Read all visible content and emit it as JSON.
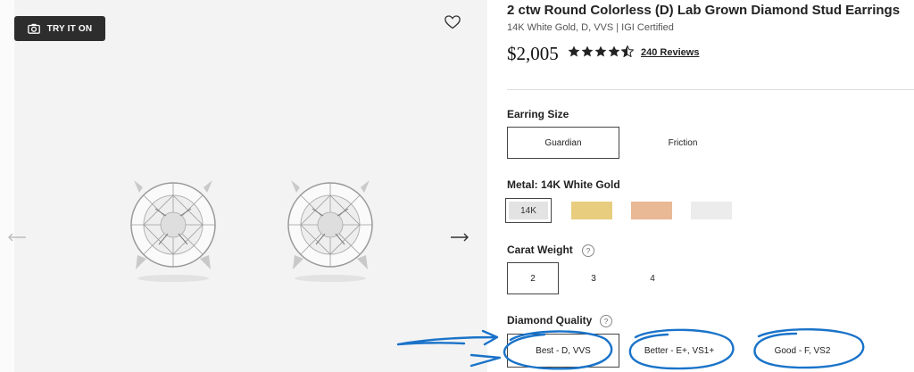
{
  "gallery": {
    "try_on_label": "TRY IT ON"
  },
  "product": {
    "title": "2 ctw Round Colorless (D) Lab Grown Diamond Stud Earrings",
    "subtitle": "14K White Gold, D, VVS | IGI Certified",
    "price": "$2,005",
    "rating": 4.5,
    "reviews_label": "240 Reviews"
  },
  "earring_size": {
    "label": "Earring Size",
    "options": [
      "Guardian",
      "Friction"
    ],
    "selected": "Guardian"
  },
  "metal": {
    "label": "Metal: 14K White Gold",
    "selected_label": "14K",
    "swatch_colors": [
      "#e3e3e3",
      "#e8cd7e",
      "#e9b895",
      "#ececec"
    ]
  },
  "carat": {
    "label": "Carat Weight",
    "help": "?",
    "options": [
      "2",
      "3",
      "4"
    ],
    "selected": "2"
  },
  "quality": {
    "label": "Diamond Quality",
    "help": "?",
    "options": [
      "Best - D, VVS",
      "Better - E+, VS1+",
      "Good - F, VS2"
    ],
    "selected": "Best - D, VVS"
  },
  "colors": {
    "annotation": "#1a73c9"
  }
}
